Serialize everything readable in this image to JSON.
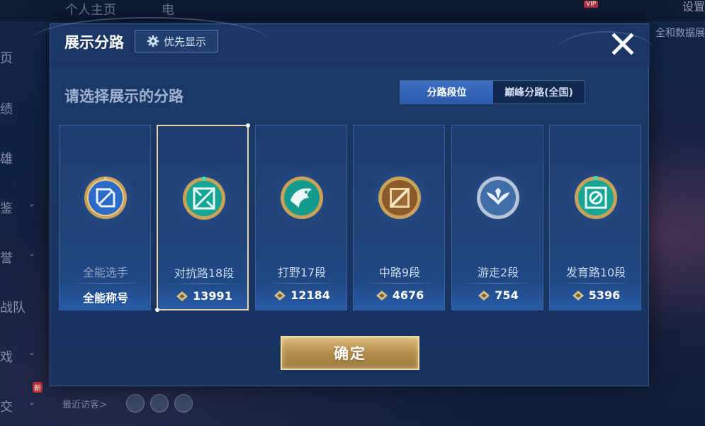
{
  "background": {
    "top_tabs": [
      "个人主页",
      "电"
    ],
    "vip": "VIP",
    "right_texts": [
      "设置",
      "全和数据展"
    ],
    "side_items": [
      "页",
      "绩",
      "雄",
      "鉴",
      "誉",
      "战队",
      "戏",
      "交"
    ],
    "new_badge": "新",
    "recent_visitors": "最近访客>"
  },
  "modal": {
    "title": "展示分路",
    "priority_label": "优先显示",
    "subtitle": "请选择展示的分路",
    "tabs": [
      {
        "label": "分路段位",
        "active": true
      },
      {
        "label": "巅峰分路(全国)",
        "active": false
      }
    ],
    "cards": [
      {
        "name": "全能选手",
        "value": "全能称号",
        "has_icon": false,
        "selected": false,
        "emblem": "allround-emblem-icon"
      },
      {
        "name": "对抗路18段",
        "value": "13991",
        "has_icon": true,
        "selected": true,
        "emblem": "clash-lane-emblem-icon"
      },
      {
        "name": "打野17段",
        "value": "12184",
        "has_icon": true,
        "selected": false,
        "emblem": "jungle-emblem-icon"
      },
      {
        "name": "中路9段",
        "value": "4676",
        "has_icon": true,
        "selected": false,
        "emblem": "mid-lane-emblem-icon"
      },
      {
        "name": "游走2段",
        "value": "754",
        "has_icon": true,
        "selected": false,
        "emblem": "roam-emblem-icon"
      },
      {
        "name": "发育路10段",
        "value": "5396",
        "has_icon": true,
        "selected": false,
        "emblem": "farm-lane-emblem-icon"
      }
    ],
    "confirm_label": "确定"
  },
  "colors": {
    "modal_bg": "#1a3663",
    "tab_active": "#3d6fc4",
    "gold": "#d9b877",
    "selected_border": "#e8d6a8"
  }
}
